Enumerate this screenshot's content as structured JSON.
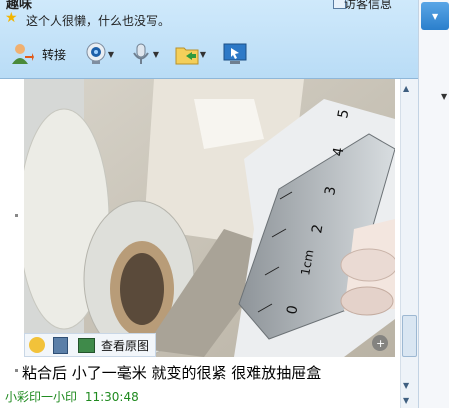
{
  "header": {
    "name": "趣味",
    "signature": "这个人很懒，什么也没写。",
    "visitor_info": "访客信息"
  },
  "toolbar": {
    "transfer_label": "转接"
  },
  "chat": {
    "image_bar": {
      "view_original_label": "查看原图"
    },
    "message": "粘合后 小了一毫米 就变的很紧 很难放抽屉盒",
    "sender": "小彩印一小印",
    "time": "11:30:48"
  },
  "photo": {
    "ruler_labels": [
      "5",
      "4",
      "3",
      "2",
      "1cm",
      "0"
    ]
  },
  "colors": {
    "header_bg": "#c4e2f8",
    "sender_green": "#1f8a1f",
    "accent_blue": "#2b7fcc"
  }
}
